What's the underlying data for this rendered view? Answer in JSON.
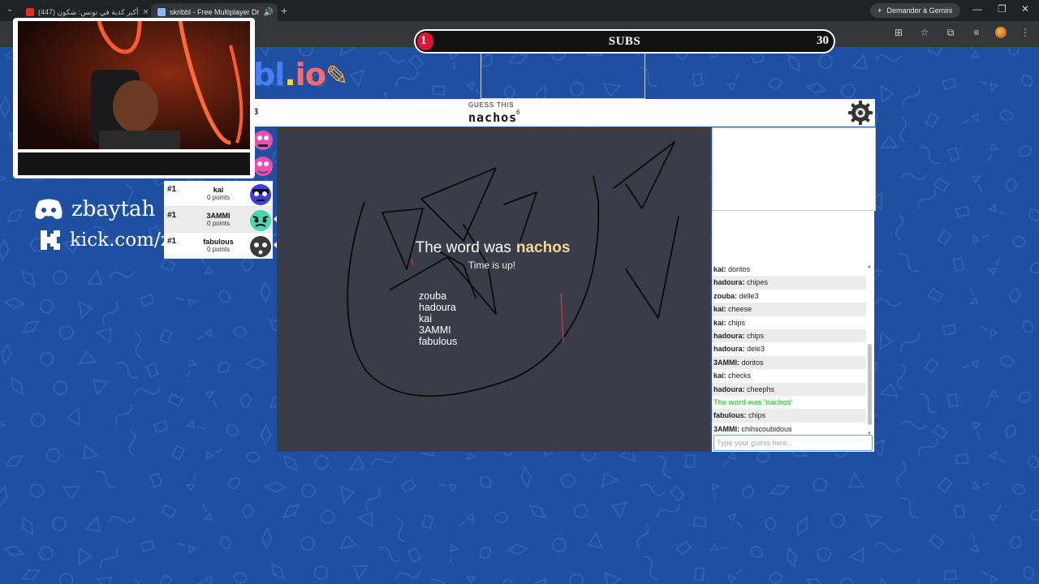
{
  "browser": {
    "tabs": [
      {
        "title": "(447) أكبر كذبة في تونس: شكون",
        "active": false
      },
      {
        "title": "skribbl - Free Multiplayer Dr",
        "active": true
      }
    ],
    "gemini_button": "Demander à Gemini"
  },
  "stream": {
    "subs_label": "SUBS",
    "subs_current": "1",
    "subs_goal": "30",
    "subs_progress": 0.033,
    "discord": "zbaytah",
    "kick": "kick.com/zbaytah"
  },
  "logo": {
    "part1": "bl",
    "part2": ".",
    "part3": "io"
  },
  "game": {
    "round_fragment": "3",
    "hint_label": "GUESS THIS",
    "word": "nachos",
    "word_length": "6",
    "overlay_prefix": "The word was",
    "overlay_word": "nachos",
    "overlay_sub": "Time is up!",
    "overlay_names": [
      "zouba",
      "hadoura",
      "kai",
      "3AMMI",
      "fabulous"
    ]
  },
  "players": [
    {
      "rank": "#1",
      "name": "kai",
      "points": "0 points",
      "bubble": ""
    },
    {
      "rank": "#1",
      "name": "3AMMI",
      "points": "0 points",
      "bubble": "chihscoubidous"
    },
    {
      "rank": "#1",
      "name": "fabulous",
      "points": "0 points",
      "bubble": "chips"
    }
  ],
  "chat": {
    "messages": [
      {
        "user": "kai",
        "text": "doritos"
      },
      {
        "user": "hadoura",
        "text": "chipes"
      },
      {
        "user": "zouba",
        "text": "delle3"
      },
      {
        "user": "kai",
        "text": "cheese"
      },
      {
        "user": "kai",
        "text": "chips"
      },
      {
        "user": "hadoura",
        "text": "chips"
      },
      {
        "user": "hadoura",
        "text": "dele3"
      },
      {
        "user": "3AMMI",
        "text": "doritos"
      },
      {
        "user": "kai",
        "text": "checks"
      },
      {
        "user": "hadoura",
        "text": "cheephs"
      },
      {
        "system": "The word was 'nachos'"
      },
      {
        "user": "fabulous",
        "text": "chips"
      },
      {
        "user": "3AMMI",
        "text": "chihscoubidous"
      }
    ],
    "input_placeholder": "Type your guess here..."
  },
  "colors": {
    "background": "#1f4fa0",
    "canvas": "#3a3d47",
    "accent_red": "#d9153a",
    "system_msg": "#3cd33c"
  }
}
